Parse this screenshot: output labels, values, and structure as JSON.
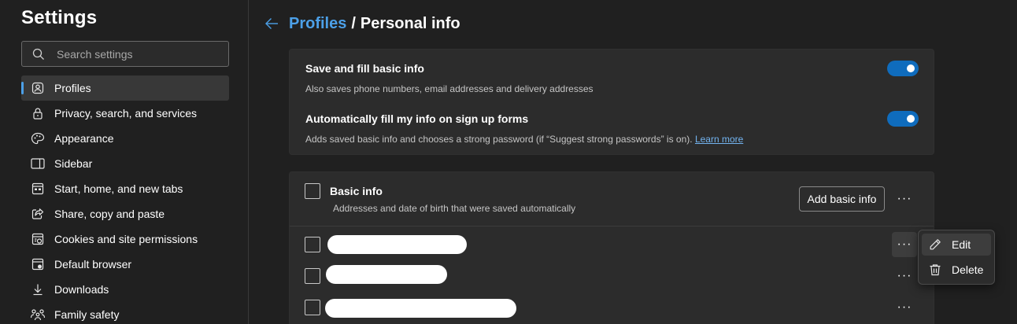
{
  "sidebar": {
    "title": "Settings",
    "search_placeholder": "Search settings",
    "items": [
      {
        "label": "Profiles",
        "icon": "profile-icon",
        "active": true
      },
      {
        "label": "Privacy, search, and services",
        "icon": "lock-icon"
      },
      {
        "label": "Appearance",
        "icon": "palette-icon"
      },
      {
        "label": "Sidebar",
        "icon": "sidebar-icon"
      },
      {
        "label": "Start, home, and new tabs",
        "icon": "home-tabs-icon"
      },
      {
        "label": "Share, copy and paste",
        "icon": "share-icon"
      },
      {
        "label": "Cookies and site permissions",
        "icon": "cookies-icon"
      },
      {
        "label": "Default browser",
        "icon": "browser-icon"
      },
      {
        "label": "Downloads",
        "icon": "download-icon"
      },
      {
        "label": "Family safety",
        "icon": "family-icon"
      }
    ]
  },
  "header": {
    "back_icon": "arrow-left-icon",
    "crumb_parent": "Profiles",
    "separator": "/",
    "crumb_current": "Personal info"
  },
  "settings": {
    "save_fill": {
      "title": "Save and fill basic info",
      "description": "Also saves phone numbers, email addresses and delivery addresses",
      "enabled": true
    },
    "auto_fill": {
      "title": "Automatically fill my info on sign up forms",
      "description": "Adds saved basic info and chooses a strong password (if “Suggest strong passwords” is on).",
      "link": "Learn more",
      "enabled": true
    }
  },
  "basic_info": {
    "title": "Basic info",
    "description": "Addresses and date of birth that were saved automatically",
    "add_button": "Add basic info",
    "more_label": "···"
  },
  "entries": [
    {
      "more_label": "···",
      "menu_open": true
    },
    {
      "more_label": "···"
    },
    {
      "more_label": "···"
    }
  ],
  "context_menu": {
    "items": [
      {
        "label": "Edit",
        "icon": "pencil-icon"
      },
      {
        "label": "Delete",
        "icon": "trash-icon"
      }
    ]
  },
  "colors": {
    "accent": "#4ca0e8",
    "toggle_on": "#0f6cbd",
    "background": "#202020",
    "card": "#2c2c2c"
  }
}
